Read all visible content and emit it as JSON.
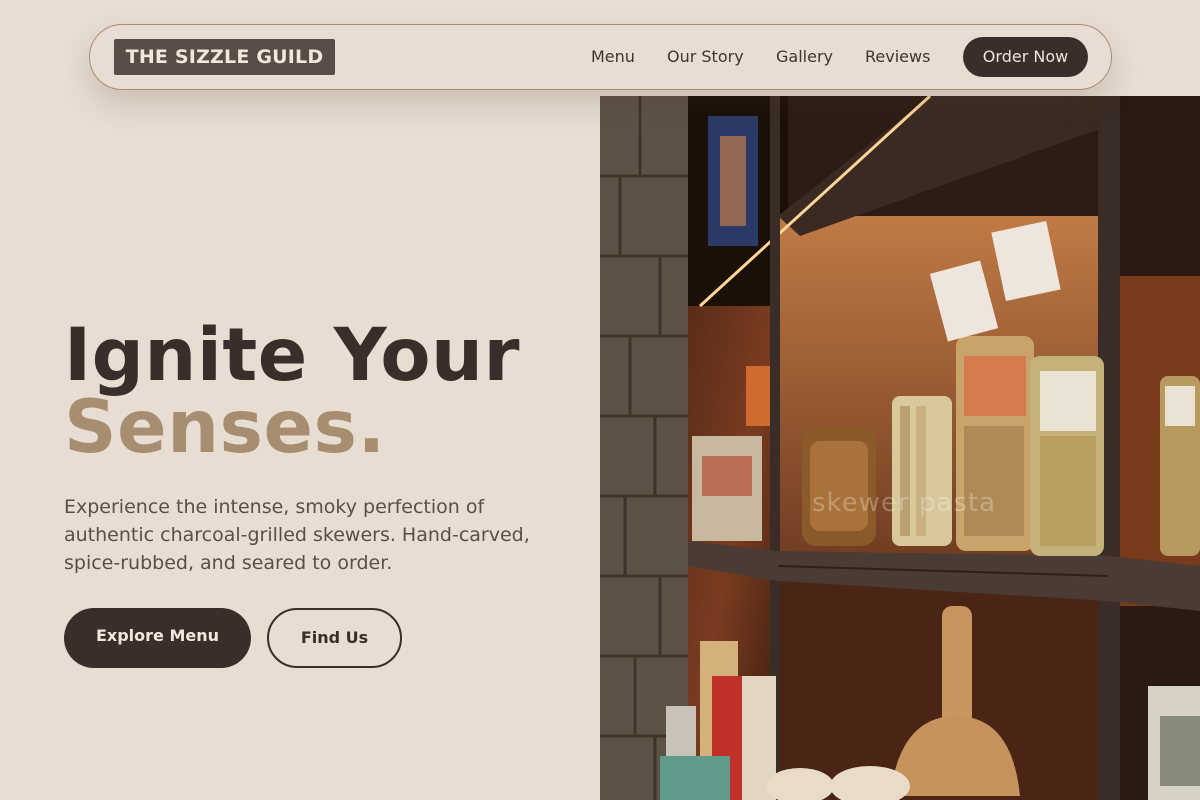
{
  "brand": {
    "name": "THE SIZZLE GUILD"
  },
  "nav": {
    "links": [
      "Menu",
      "Our Story",
      "Gallery",
      "Reviews"
    ],
    "cta": "Order Now"
  },
  "hero": {
    "title_line1": "Ignite Your",
    "title_line2": "Senses.",
    "subtitle": "Experience the intense, smoky perfection of authentic charcoal-grilled skewers. Hand-carved, spice-rubbed, and seared to order.",
    "primary_button": "Explore Menu",
    "secondary_button": "Find Us"
  },
  "image": {
    "watermark": "skewer pasta",
    "description": "store-shelves-photo"
  },
  "colors": {
    "background": "#e8ddd3",
    "dark": "#3a2e2a",
    "accent": "#a88e70",
    "logo_bg": "#5a4d48"
  }
}
